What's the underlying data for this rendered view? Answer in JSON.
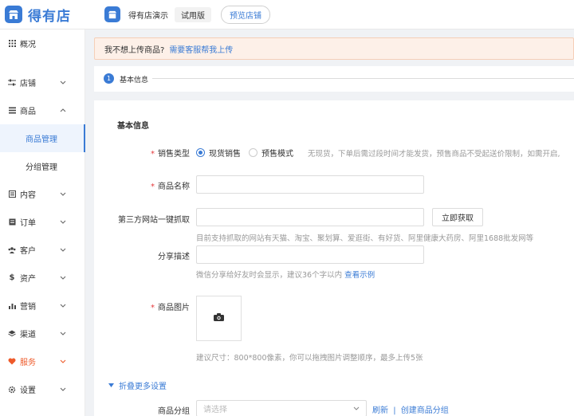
{
  "header": {
    "logo_text": "得有店",
    "shop_name": "得有店演示",
    "trial_badge": "试用版",
    "preview_button": "预览店铺"
  },
  "sidebar": {
    "items": [
      {
        "label": "概况",
        "icon": "grid-icon"
      },
      {
        "label": "店铺",
        "icon": "sliders-icon"
      },
      {
        "label": "商品",
        "icon": "list-icon"
      },
      {
        "label": "商品管理"
      },
      {
        "label": "分组管理"
      },
      {
        "label": "内容",
        "icon": "document-icon"
      },
      {
        "label": "订单",
        "icon": "receipt-icon"
      },
      {
        "label": "客户",
        "icon": "users-icon"
      },
      {
        "label": "资产",
        "icon": "dollar-icon"
      },
      {
        "label": "营销",
        "icon": "bar-chart-icon"
      },
      {
        "label": "渠道",
        "icon": "layers-icon"
      },
      {
        "label": "服务",
        "icon": "heart-icon"
      },
      {
        "label": "设置",
        "icon": "gear-icon"
      }
    ]
  },
  "notice": {
    "text": "我不想上传商品?",
    "link": "需要客服帮我上传"
  },
  "steps": {
    "current_number": "1",
    "current_label": "基本信息"
  },
  "form": {
    "section_title": "基本信息",
    "sale_type": {
      "label": "销售类型",
      "options": [
        "现货销售",
        "预售模式"
      ],
      "selected": "现货销售",
      "hint": "无现货，下单后需过段时间才能发货，预售商品不受起送价限制，如需开启,"
    },
    "product_name": {
      "label": "商品名称",
      "value": ""
    },
    "third_party": {
      "label": "第三方网站一键抓取",
      "value": "",
      "button": "立即获取",
      "hint": "目前支持抓取的网站有天猫、淘宝、聚划算、爱逛街、有好货、阿里健康大药房、阿里1688批发网等"
    },
    "share_desc": {
      "label": "分享描述",
      "value": "",
      "hint": "微信分享给好友时会显示，建议36个字以内",
      "hint_link": "查看示例"
    },
    "product_image": {
      "label": "商品图片",
      "hint": "建议尺寸：800*800像素，你可以拖拽图片调整顺序，最多上传5张"
    },
    "more_settings": "折叠更多设置",
    "group": {
      "label": "商品分组",
      "placeholder": "请选择",
      "refresh": "刷新",
      "separator": "|",
      "create": "创建商品分组"
    }
  },
  "colors": {
    "accent": "#3a7bd5",
    "required": "#e4393c",
    "service": "#ee5a2a",
    "notice_bg": "#fdf0e8"
  }
}
